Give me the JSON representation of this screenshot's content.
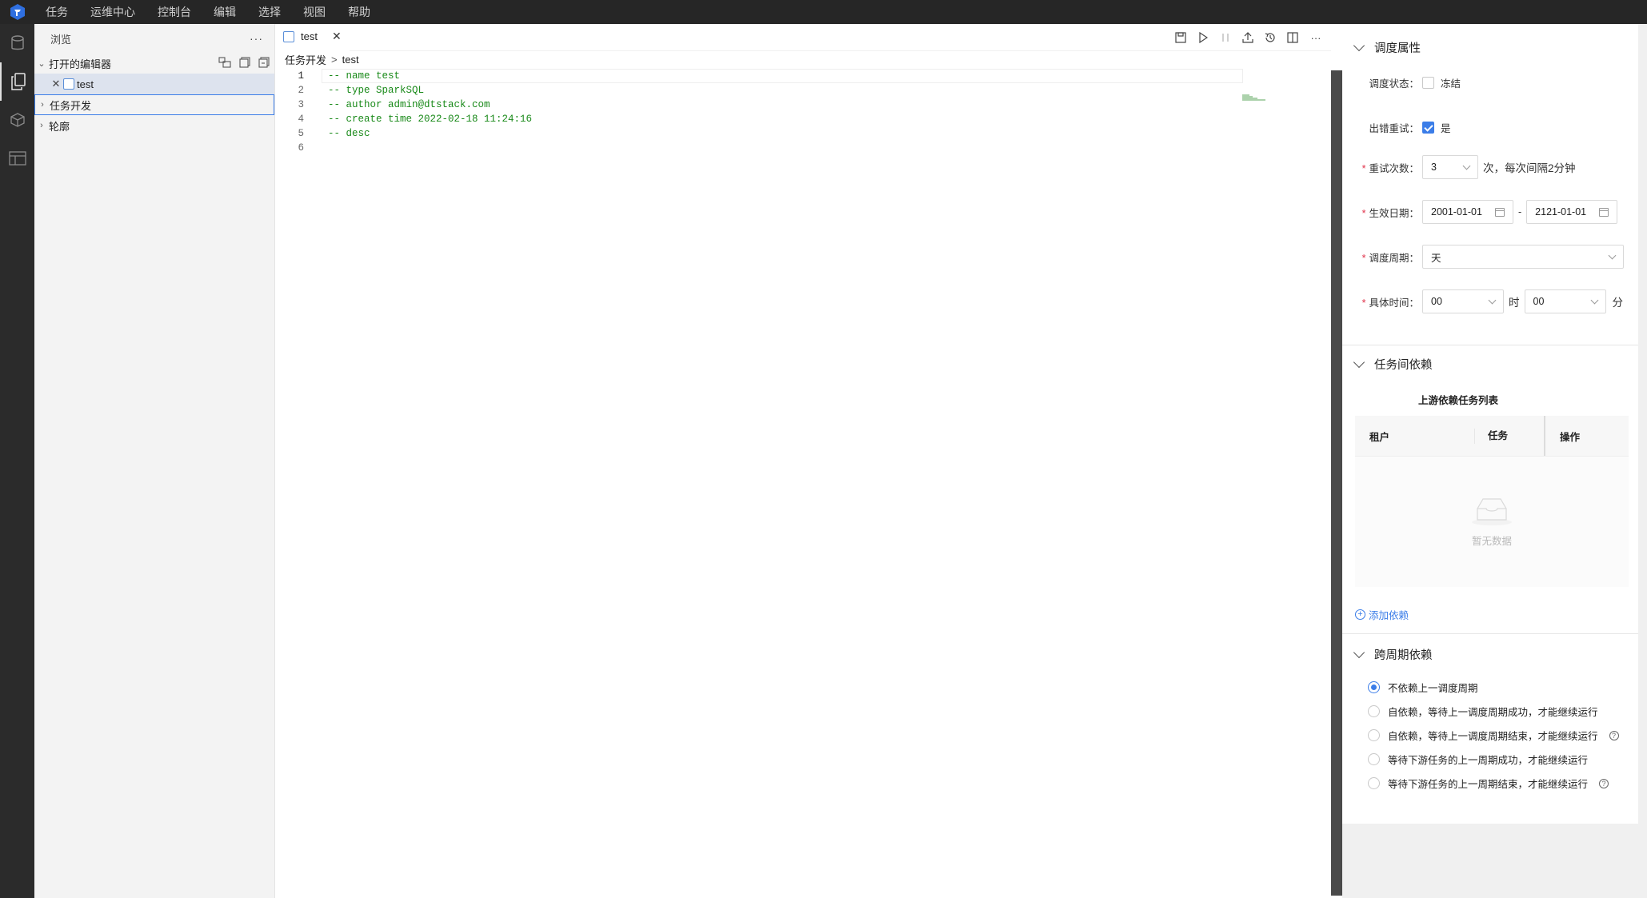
{
  "menubar": {
    "items": [
      "任务",
      "运维中心",
      "控制台",
      "编辑",
      "选择",
      "视图",
      "帮助"
    ]
  },
  "sidebar": {
    "title": "浏览",
    "more": "···",
    "open_editors": "打开的编辑器",
    "open_file": "test",
    "task_dev": "任务开发",
    "outline": "轮廓"
  },
  "editor": {
    "tab_label": "test",
    "breadcrumb": [
      "任务开发",
      "test"
    ],
    "breadcrumb_sep": ">",
    "lines": [
      "-- name test",
      "-- type SparkSQL",
      "-- author admin@dtstack.com",
      "-- create time 2022-02-18 11:24:16",
      "-- desc",
      ""
    ],
    "line_numbers": [
      "1",
      "2",
      "3",
      "4",
      "5",
      "6"
    ],
    "more": "···"
  },
  "schedule": {
    "title": "调度属性",
    "status_label": "调度状态：",
    "freeze_label": "冻结",
    "freeze_checked": false,
    "retry_label": "出错重试：",
    "retry_value_label": "是",
    "retry_checked": true,
    "retry_count_label": "重试次数：",
    "retry_count": "3",
    "retry_suffix": "次，每次间隔2分钟",
    "effective_label": "生效日期：",
    "start_date": "2001-01-01",
    "date_sep": "-",
    "end_date": "2121-01-01",
    "period_label": "调度周期：",
    "period": "天",
    "time_label": "具体时间：",
    "hour": "00",
    "hour_unit": "时",
    "minute": "00",
    "minute_unit": "分"
  },
  "dependency": {
    "title": "任务间依赖",
    "table_title": "上游依赖任务列表",
    "columns": [
      "租户",
      "任务",
      "操作"
    ],
    "empty_text": "暂无数据",
    "add_link": "添加依赖"
  },
  "cross_period": {
    "title": "跨周期依赖",
    "options": [
      {
        "label": "不依赖上一调度周期",
        "selected": true,
        "help": false
      },
      {
        "label": "自依赖，等待上一调度周期成功，才能继续运行",
        "selected": false,
        "help": false
      },
      {
        "label": "自依赖，等待上一调度周期结束，才能继续运行",
        "selected": false,
        "help": true
      },
      {
        "label": "等待下游任务的上一周期成功，才能继续运行",
        "selected": false,
        "help": false
      },
      {
        "label": "等待下游任务的上一周期结束，才能继续运行",
        "selected": false,
        "help": true
      }
    ]
  },
  "colors": {
    "accent": "#3b7de8",
    "menubar_bg": "#262626",
    "code_comment": "#1a8a1a",
    "required": "#e0334b"
  }
}
